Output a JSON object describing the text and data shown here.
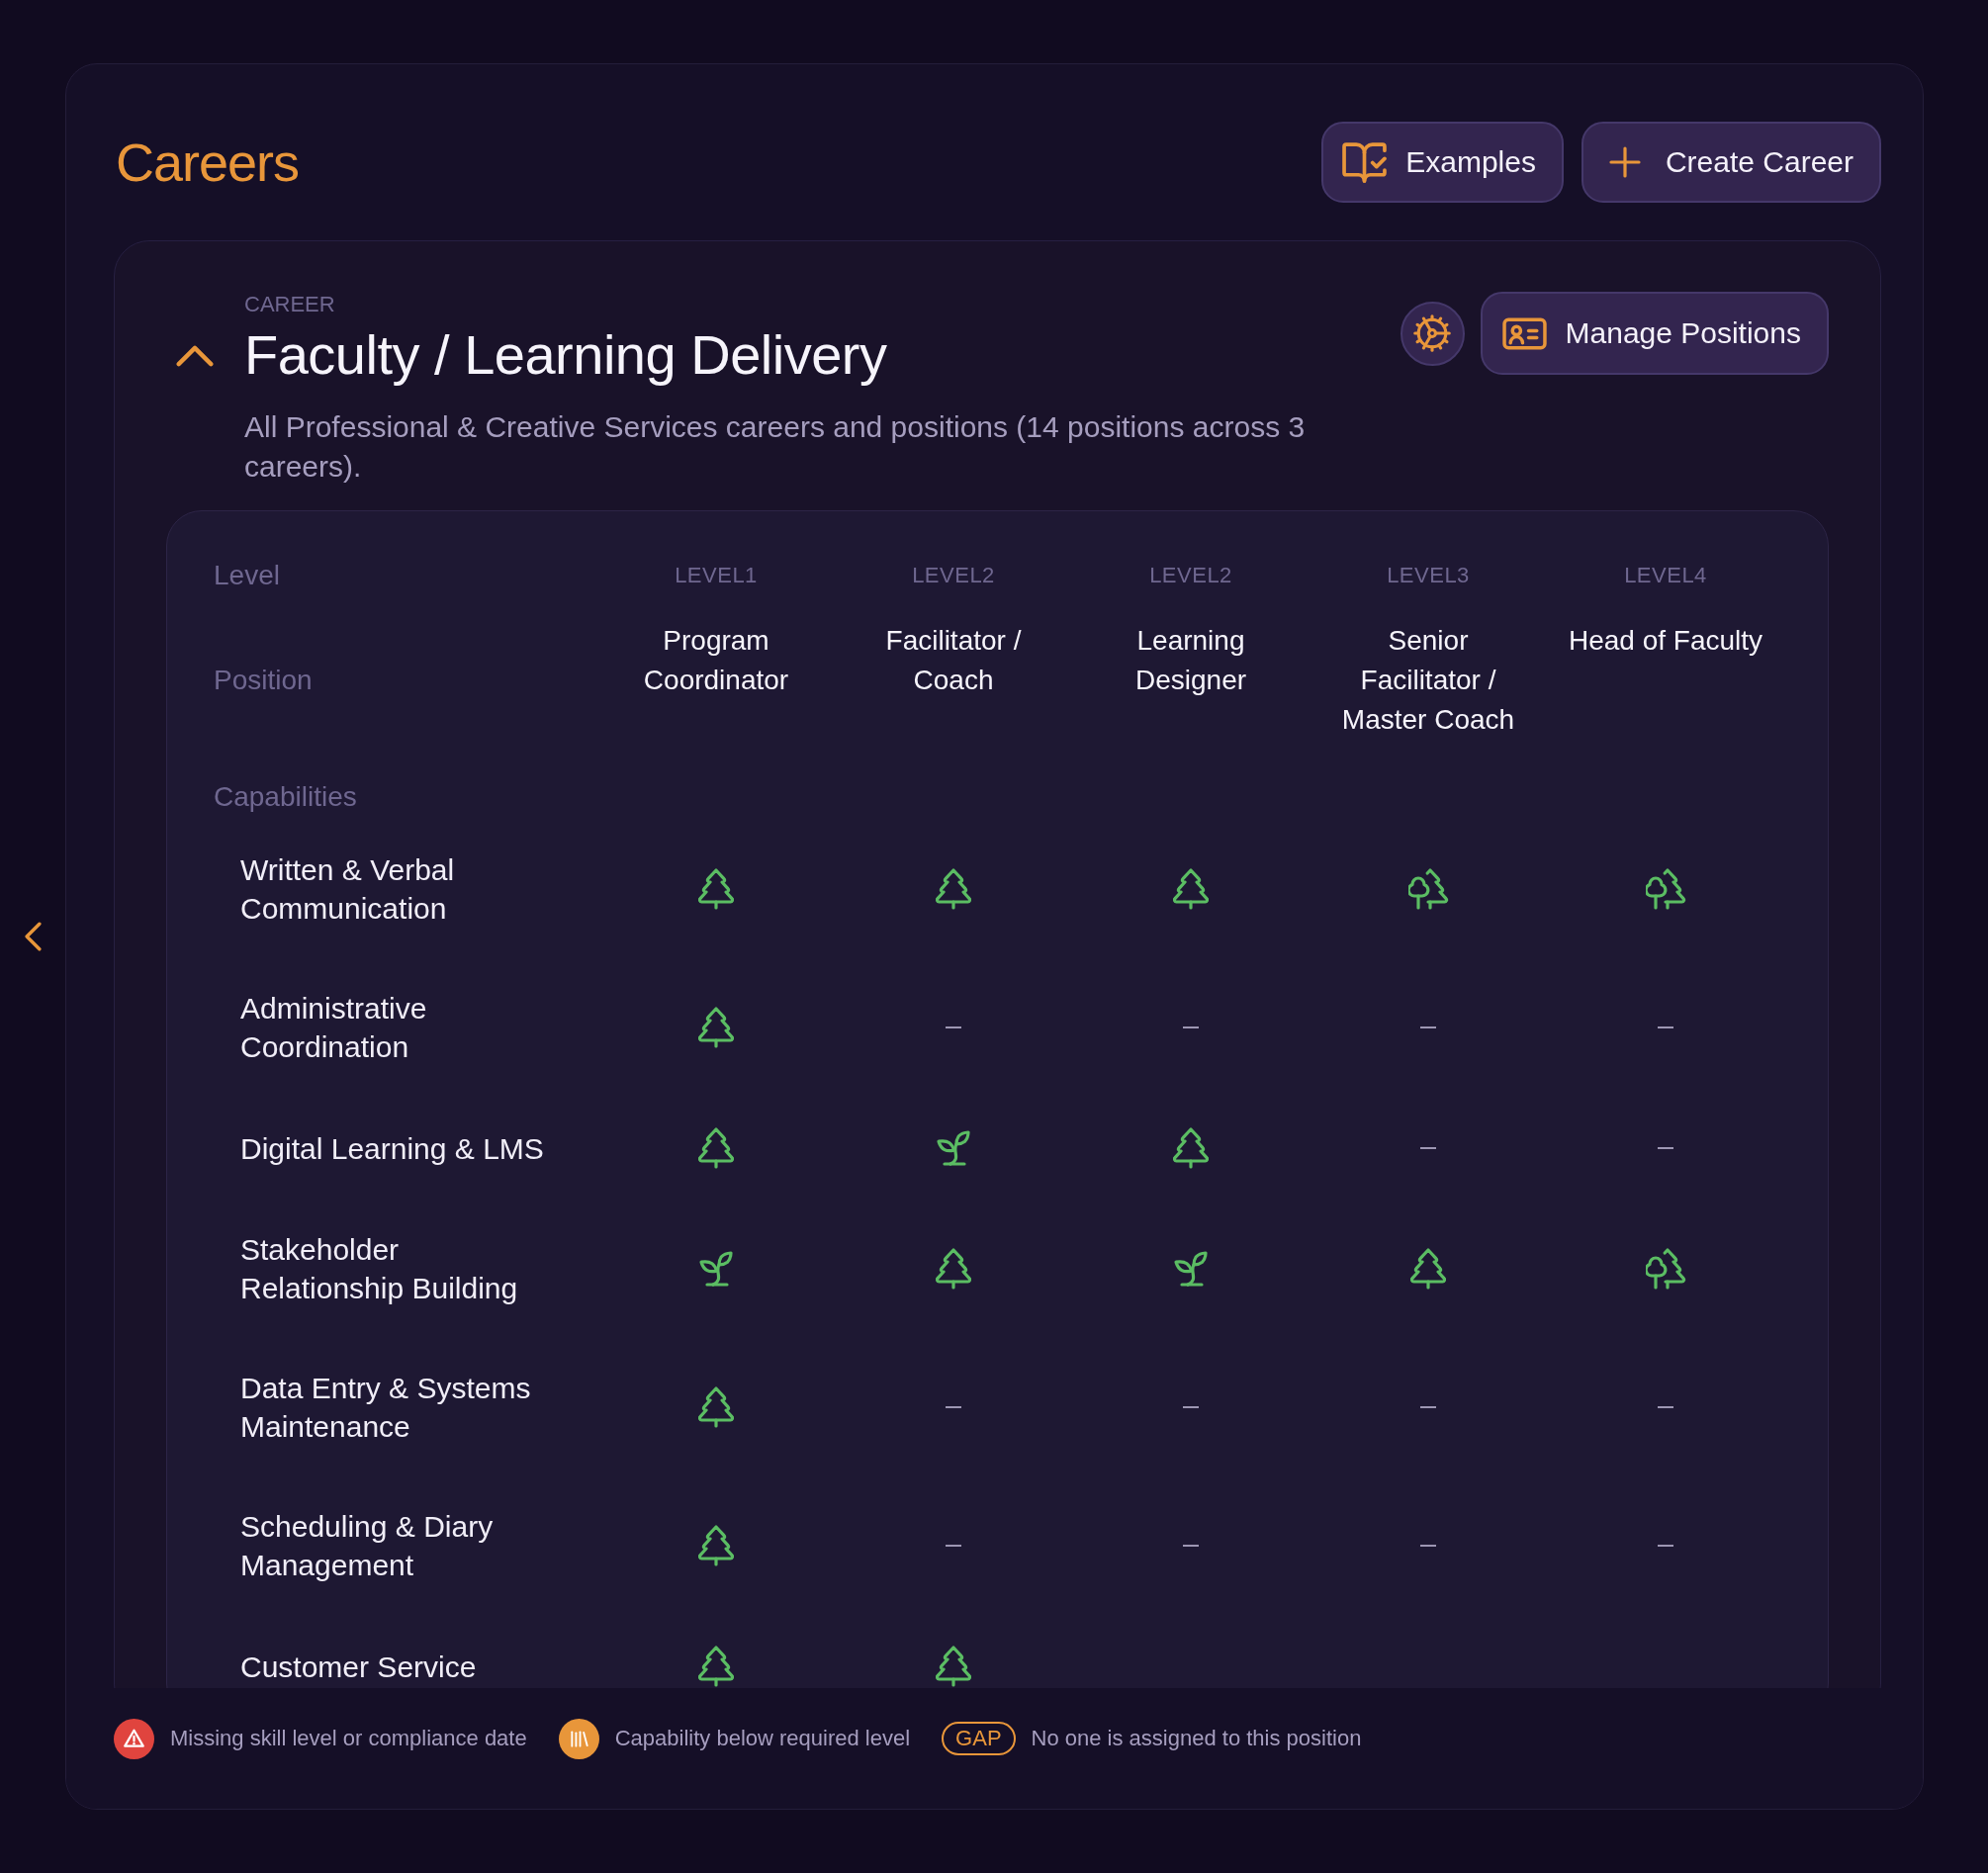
{
  "header": {
    "title": "Careers",
    "buttons": [
      {
        "kind": "examples",
        "label": "Examples"
      },
      {
        "kind": "create",
        "label": "Create Career"
      }
    ]
  },
  "career": {
    "eyebrow": "CAREER",
    "title": "Faculty / Learning Delivery",
    "expanded": true,
    "description": "All Professional & Creative Services careers and positions (14 positions across 3 careers).",
    "manage_button": {
      "label": "Manage Positions"
    }
  },
  "matrix": {
    "level_heading": "Level",
    "position_heading": "Position",
    "capabilities_heading": "Capabilities",
    "positions": [
      {
        "level": "LEVEL1",
        "name": "Program Coordinator"
      },
      {
        "level": "LEVEL2",
        "name": "Facilitator / Coach"
      },
      {
        "level": "LEVEL2",
        "name": "Learning Designer"
      },
      {
        "level": "LEVEL3",
        "name": "Senior Facilitator / Master Coach"
      },
      {
        "level": "LEVEL4",
        "name": "Head of Faculty"
      }
    ],
    "capabilities": [
      {
        "name": "Written & Verbal Communication",
        "cells": [
          {
            "kind": "tree"
          },
          {
            "kind": "tree"
          },
          {
            "kind": "tree"
          },
          {
            "kind": "forest"
          },
          {
            "kind": "forest"
          }
        ]
      },
      {
        "name": "Administrative Coordination",
        "cells": [
          {
            "kind": "tree"
          },
          {
            "kind": "none"
          },
          {
            "kind": "none"
          },
          {
            "kind": "none"
          },
          {
            "kind": "none"
          }
        ]
      },
      {
        "name": "Digital Learning & LMS",
        "cells": [
          {
            "kind": "tree"
          },
          {
            "kind": "sprout"
          },
          {
            "kind": "tree"
          },
          {
            "kind": "none"
          },
          {
            "kind": "none"
          }
        ]
      },
      {
        "name": "Stakeholder Relationship Building",
        "cells": [
          {
            "kind": "sprout"
          },
          {
            "kind": "tree"
          },
          {
            "kind": "sprout"
          },
          {
            "kind": "tree"
          },
          {
            "kind": "forest"
          }
        ]
      },
      {
        "name": "Data Entry & Systems Maintenance",
        "cells": [
          {
            "kind": "tree"
          },
          {
            "kind": "none"
          },
          {
            "kind": "none"
          },
          {
            "kind": "none"
          },
          {
            "kind": "none"
          }
        ]
      },
      {
        "name": "Scheduling & Diary Management",
        "cells": [
          {
            "kind": "tree"
          },
          {
            "kind": "none"
          },
          {
            "kind": "none"
          },
          {
            "kind": "none"
          },
          {
            "kind": "none"
          }
        ]
      },
      {
        "name": "Customer Service",
        "cells": [
          {
            "kind": "tree"
          },
          {
            "kind": "tree"
          }
        ]
      }
    ]
  },
  "legend": [
    {
      "kind": "warning",
      "text": "Missing skill level or compliance date"
    },
    {
      "kind": "below",
      "text": "Capability below required level"
    },
    {
      "kind": "gap",
      "badge": "GAP",
      "text": "No one is assigned to this position"
    }
  ]
}
